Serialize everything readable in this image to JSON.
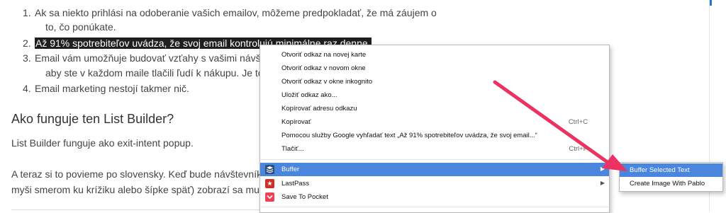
{
  "article": {
    "list": [
      {
        "num": "1.",
        "line1": "Ak sa niekto prihlási na odoberanie vašich emailov, môžeme predpokladať, že má záujem o",
        "line2": "to, čo ponúkate."
      },
      {
        "num": "2.",
        "line1": "Až 91% spotrebiteľov uvádza, že svoj email kontrolujú minimálne raz denne."
      },
      {
        "num": "3.",
        "line1": "Email vám umožňuje budovať vzťahy s vašimi návštev",
        "line2": "aby ste v každom maile tlačili ľudí k nákupu. Je to ove"
      },
      {
        "num": "4.",
        "line1": "Email marketing nestojí takmer nič."
      }
    ],
    "heading": "Ako funguje ten List Builder?",
    "para1": "List Builder funguje ako exit-intent popup.",
    "para2_line1": "A teraz si to povieme po slovensky. Keď bude návštevník o",
    "para2_line2": "myši smerom ku krížiku alebo šípke späť) zobrazí sa mu vy"
  },
  "context_menu": {
    "items": [
      {
        "label": "Otvoriť odkaz na novej karte"
      },
      {
        "label": "Otvoriť odkaz v novom okne"
      },
      {
        "label": "Otvoriť odkaz v okne inkognito"
      },
      {
        "label": "Uložiť odkaz ako..."
      },
      {
        "label": "Kopírovať adresu odkazu"
      },
      {
        "label": "Kopírovať",
        "shortcut": "Ctrl+C"
      },
      {
        "label": "Pomocou služby Google vyhľadať text „Až 91% spotrebiteľov uvádza, že svoj email...“"
      },
      {
        "label": "Tlačiť...",
        "shortcut": "Ctrl+P"
      }
    ],
    "extensions": [
      {
        "label": "Buffer",
        "icon": "buffer-icon",
        "color": "#2c4f7c"
      },
      {
        "label": "LastPass",
        "icon": "lastpass-icon",
        "color": "#d32d27"
      },
      {
        "label": "Save To Pocket",
        "icon": "pocket-icon",
        "color": "#ef4056"
      }
    ]
  },
  "submenu": {
    "items": [
      {
        "label": "Buffer Selected Text"
      },
      {
        "label": "Create Image With Pablo"
      }
    ]
  },
  "colors": {
    "selection": "#4a86de",
    "highlight": "#1f1f1f",
    "annotation_arrow": "#ec3263"
  }
}
